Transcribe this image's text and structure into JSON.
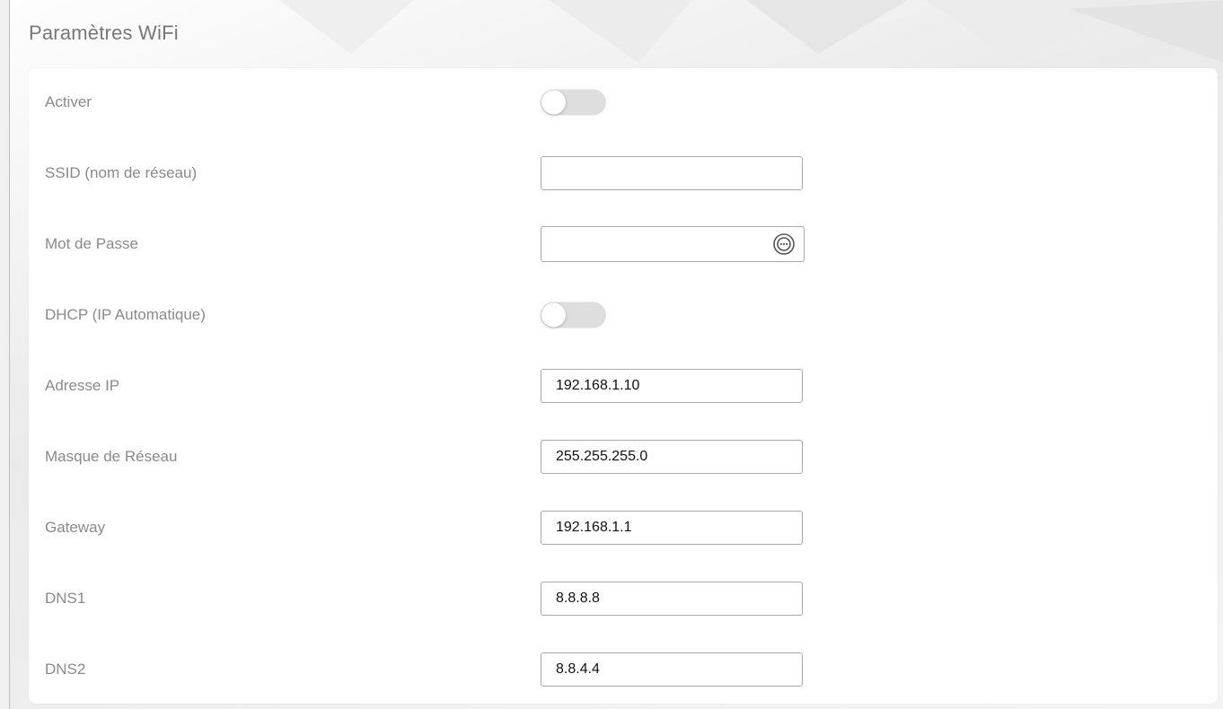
{
  "page": {
    "title": "Paramètres WiFi"
  },
  "fields": {
    "activer": {
      "label": "Activer",
      "enabled": false
    },
    "ssid": {
      "label": "SSID (nom de réseau)",
      "value": ""
    },
    "password": {
      "label": "Mot de Passe",
      "value": "",
      "icon": "show-password-icon"
    },
    "dhcp": {
      "label": "DHCP (IP Automatique)",
      "enabled": false
    },
    "ip": {
      "label": "Adresse IP",
      "value": "192.168.1.10"
    },
    "netmask": {
      "label": "Masque de Réseau",
      "value": "255.255.255.0"
    },
    "gateway": {
      "label": "Gateway",
      "value": "192.168.1.1"
    },
    "dns1": {
      "label": "DNS1",
      "value": "8.8.8.8"
    },
    "dns2": {
      "label": "DNS2",
      "value": "8.8.4.4"
    }
  },
  "colors": {
    "label": "#8a8a8a",
    "toggle_off": "#dedede",
    "card": "#ffffff",
    "title": "#777777"
  }
}
